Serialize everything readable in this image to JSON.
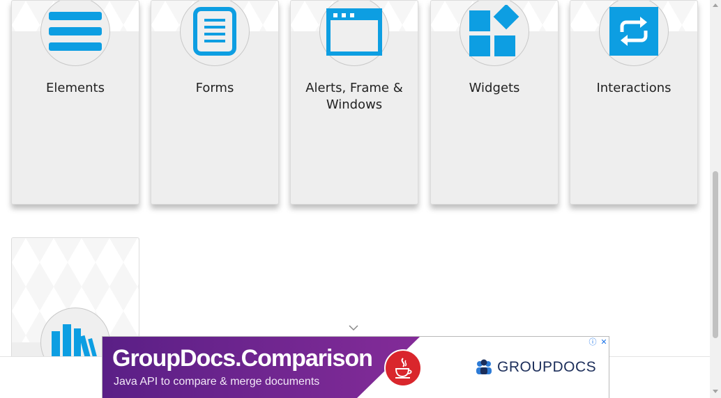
{
  "cards": [
    {
      "title": "Elements",
      "icon": "menu-lines-icon"
    },
    {
      "title": "Forms",
      "icon": "document-icon"
    },
    {
      "title": "Alerts, Frame & Windows",
      "icon": "browser-window-icon"
    },
    {
      "title": "Widgets",
      "icon": "widgets-blocks-icon"
    },
    {
      "title": "Interactions",
      "icon": "repeat-arrows-icon"
    }
  ],
  "card6": {
    "icon": "bookshelf-icon"
  },
  "ad": {
    "title": "GroupDocs.Comparison",
    "subtitle": "Java API to compare & merge documents",
    "brand": "GROUPDOCS",
    "info_symbol": "ⓘ",
    "close_symbol": "✕"
  },
  "colors": {
    "accent": "#0d9ee2",
    "ad_purple": "#6b2490",
    "java_red": "#d9262c"
  }
}
